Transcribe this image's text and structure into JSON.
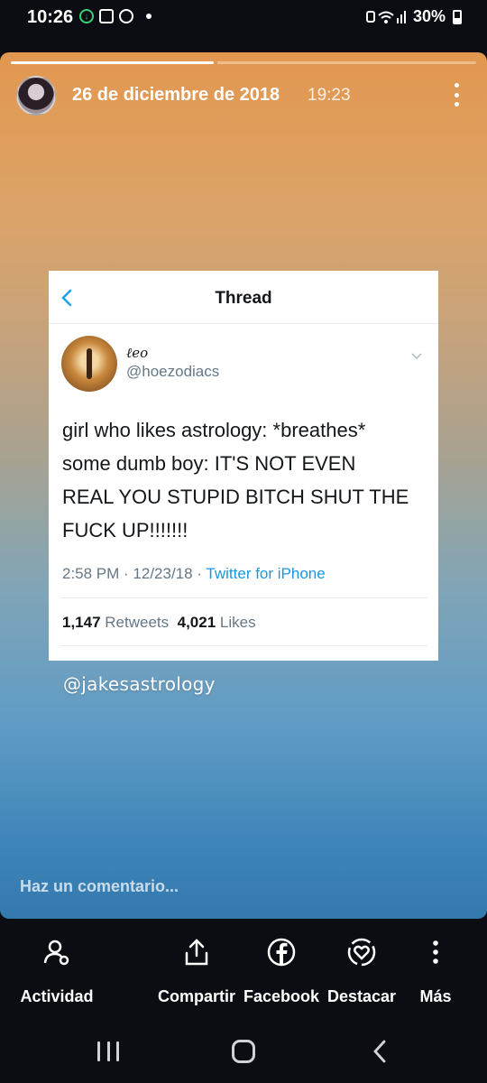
{
  "status_bar": {
    "time": "10:26",
    "battery": "30%"
  },
  "story": {
    "date": "26 de diciembre de 2018",
    "time": "19:23",
    "caption": "@jakesastrology",
    "comment_placeholder": "Haz un comentario..."
  },
  "tweet": {
    "header_title": "Thread",
    "display_name": "ℓeo",
    "handle": "@hoezodiacs",
    "text_lines": [
      "girl who likes astrology: *breathes*",
      "some dumb boy: IT'S NOT EVEN",
      "REAL YOU STUPID BITCH SHUT THE",
      "FUCK UP!!!!!!!"
    ],
    "time": "2:58 PM",
    "date": "12/23/18",
    "source": "Twitter for iPhone",
    "retweets": "1,147",
    "retweets_label": "Retweets",
    "likes": "4,021",
    "likes_label": "Likes"
  },
  "actions": [
    {
      "label": "Actividad",
      "icon": "activity-people-icon"
    },
    {
      "label": "Compartir",
      "icon": "share-icon"
    },
    {
      "label": "Facebook",
      "icon": "facebook-icon"
    },
    {
      "label": "Destacar",
      "icon": "highlight-heart-icon"
    },
    {
      "label": "Más",
      "icon": "more-vertical-icon"
    }
  ],
  "colors": {
    "gradient_top": "#e2974f",
    "gradient_bottom": "#3479ad",
    "twitter_link": "#1b95e0"
  }
}
